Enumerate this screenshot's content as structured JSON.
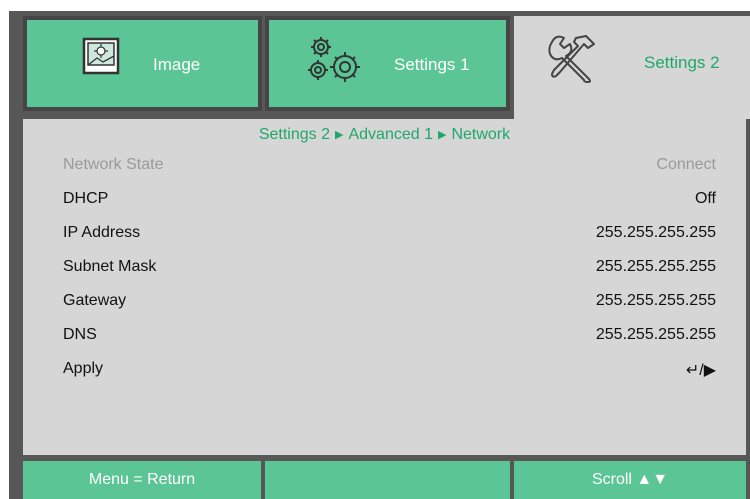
{
  "tabs": [
    {
      "label": "Image",
      "icon": "image-icon",
      "active": false
    },
    {
      "label": "Settings 1",
      "icon": "gears-icon",
      "active": false
    },
    {
      "label": "Settings 2",
      "icon": "tools-icon",
      "active": true
    }
  ],
  "breadcrumb": [
    "Settings 2",
    "Advanced 1",
    "Network"
  ],
  "breadcrumb_separator": "▶",
  "rows": [
    {
      "label": "Network State",
      "value": "Connect",
      "enabled": false
    },
    {
      "label": "DHCP",
      "value": "Off",
      "enabled": true
    },
    {
      "label": "IP Address",
      "value": "255.255.255.255",
      "enabled": true
    },
    {
      "label": "Subnet Mask",
      "value": "255.255.255.255",
      "enabled": true
    },
    {
      "label": "Gateway",
      "value": "255.255.255.255",
      "enabled": true
    },
    {
      "label": "DNS",
      "value": "255.255.255.255",
      "enabled": true
    },
    {
      "label": "Apply",
      "value": "↵/▶",
      "enabled": true
    }
  ],
  "footer": {
    "left": "Menu = Return",
    "middle": "",
    "right": "Scroll ▲▼"
  },
  "colors": {
    "accent": "#5bc595",
    "accent_text": "#1ea86a",
    "panel": "#d6d6d6",
    "frame": "#575757"
  }
}
